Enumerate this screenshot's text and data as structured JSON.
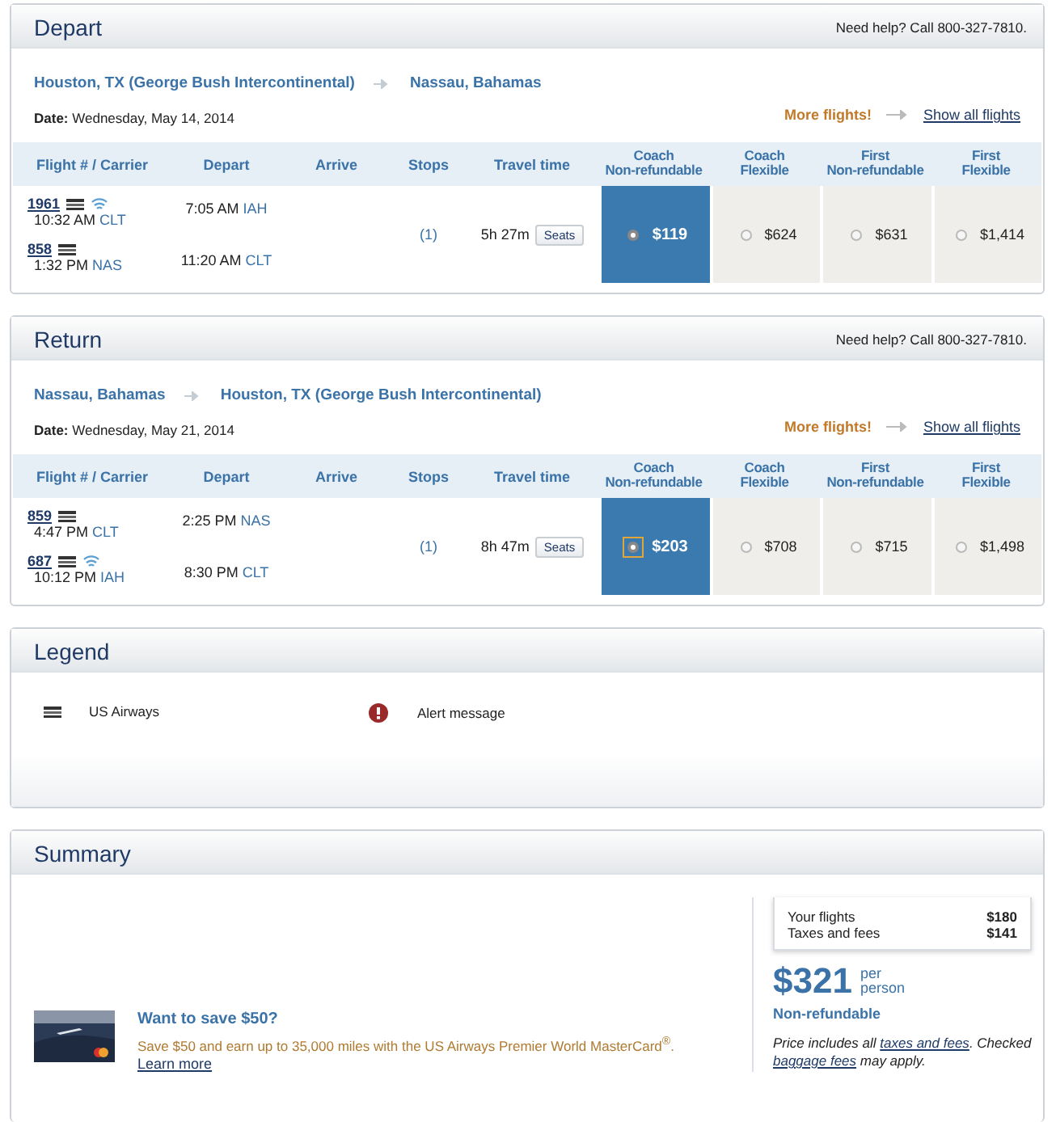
{
  "trips": [
    {
      "title": "Depart",
      "help": "Need help? Call 800-327-7810.",
      "from": "Houston, TX (George Bush Intercontinental)",
      "to": "Nassau, Bahamas",
      "date_label": "Date:",
      "date": "Wednesday, May 14, 2014",
      "more_flights": "More flights!",
      "show_all": "Show all flights",
      "columns": [
        "Flight # / Carrier",
        "Depart",
        "Arrive",
        "Stops",
        "Travel time"
      ],
      "fare_columns": [
        [
          "Coach",
          "Non-refundable"
        ],
        [
          "Coach",
          "Flexible"
        ],
        [
          "First",
          "Non-refundable"
        ],
        [
          "First",
          "Flexible"
        ]
      ],
      "segments": [
        {
          "number": "1961",
          "wifi": true,
          "arrive_time": "10:32 AM",
          "arrive_code": "CLT",
          "depart_time": "7:05 AM",
          "depart_code": "IAH"
        },
        {
          "number": "858",
          "wifi": false,
          "arrive_time": "1:32 PM",
          "arrive_code": "NAS",
          "depart_time": "11:20 AM",
          "depart_code": "CLT"
        }
      ],
      "stops": "(1)",
      "travel_time": "5h 27m",
      "seats": "Seats",
      "fares": [
        {
          "price": "$119",
          "selected": true,
          "focused": false
        },
        {
          "price": "$624",
          "selected": false,
          "focused": false
        },
        {
          "price": "$631",
          "selected": false,
          "focused": false
        },
        {
          "price": "$1,414",
          "selected": false,
          "focused": false
        }
      ]
    },
    {
      "title": "Return",
      "help": "Need help? Call 800-327-7810.",
      "from": "Nassau, Bahamas",
      "to": "Houston, TX (George Bush Intercontinental)",
      "date_label": "Date:",
      "date": "Wednesday, May 21, 2014",
      "more_flights": "More flights!",
      "show_all": "Show all flights",
      "columns": [
        "Flight # / Carrier",
        "Depart",
        "Arrive",
        "Stops",
        "Travel time"
      ],
      "fare_columns": [
        [
          "Coach",
          "Non-refundable"
        ],
        [
          "Coach",
          "Flexible"
        ],
        [
          "First",
          "Non-refundable"
        ],
        [
          "First",
          "Flexible"
        ]
      ],
      "segments": [
        {
          "number": "859",
          "wifi": false,
          "arrive_time": "4:47 PM",
          "arrive_code": "CLT",
          "depart_time": "2:25 PM",
          "depart_code": "NAS"
        },
        {
          "number": "687",
          "wifi": true,
          "arrive_time": "10:12 PM",
          "arrive_code": "IAH",
          "depart_time": "8:30 PM",
          "depart_code": "CLT"
        }
      ],
      "stops": "(1)",
      "travel_time": "8h 47m",
      "seats": "Seats",
      "fares": [
        {
          "price": "$203",
          "selected": true,
          "focused": true
        },
        {
          "price": "$708",
          "selected": false,
          "focused": false
        },
        {
          "price": "$715",
          "selected": false,
          "focused": false
        },
        {
          "price": "$1,498",
          "selected": false,
          "focused": false
        }
      ]
    }
  ],
  "legend": {
    "title": "Legend",
    "items": [
      {
        "kind": "carrier",
        "label": "US Airways"
      },
      {
        "kind": "alert",
        "label": "Alert message"
      }
    ]
  },
  "summary": {
    "title": "Summary",
    "promo": {
      "title": "Want to save $50?",
      "text": "Save $50 and earn up to 35,000 miles with the US Airways Premier World MasterCard$^{®}$.",
      "link": "Learn more"
    },
    "breakdown": [
      {
        "label": "Your flights",
        "amount": "$180"
      },
      {
        "label": "Taxes and fees",
        "amount": "$141"
      }
    ],
    "total": "$321",
    "per": "per person",
    "fare_type": "Non-refundable",
    "note": [
      {
        "kind": "text",
        "text": "Price includes all "
      },
      {
        "kind": "link",
        "text": "taxes and fees"
      },
      {
        "kind": "text",
        "text": ". Checked "
      },
      {
        "kind": "link",
        "text": "baggage fees"
      },
      {
        "kind": "text",
        "text": " may apply."
      }
    ]
  }
}
